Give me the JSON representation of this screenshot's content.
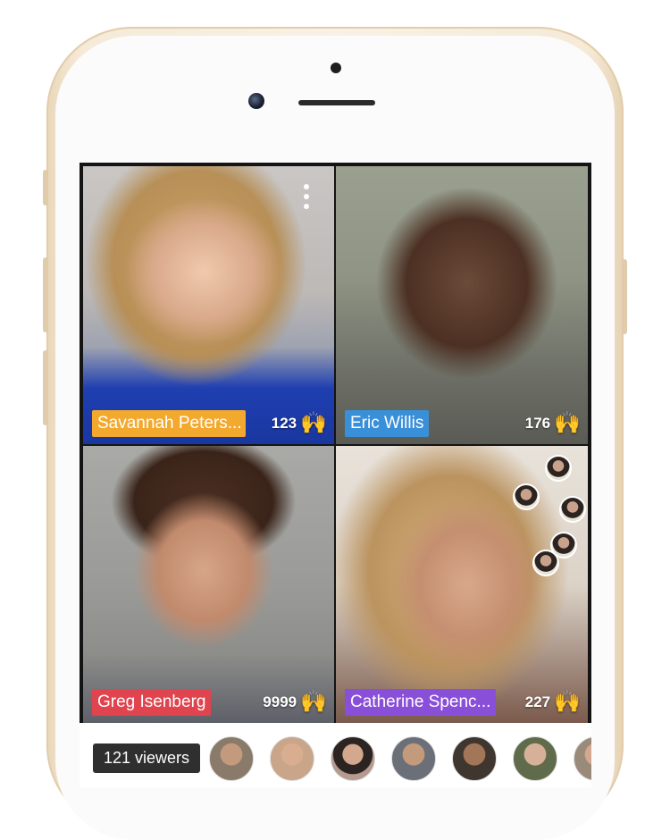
{
  "participants": [
    {
      "name": "Savannah Peters...",
      "claps": "123",
      "tag_color": "#f2a92e"
    },
    {
      "name": "Eric Willis",
      "claps": "176",
      "tag_color": "#3a8fd9"
    },
    {
      "name": "Greg Isenberg",
      "claps": "9999",
      "tag_color": "#e0444e"
    },
    {
      "name": "Catherine Spenc...",
      "claps": "227",
      "tag_color": "#8a4fd8"
    }
  ],
  "clap_icon": "raised-hands-icon",
  "clap_glyph": "🙌",
  "menu_icon": "vertical-dots-icon",
  "viewers": {
    "count_label": "121 viewers",
    "avatar_colors": [
      "#8a7a6a",
      "#c9a58a",
      "#b49a8f",
      "#6a6f78",
      "#3f3630",
      "#5f6b4a",
      "#9a8a7a"
    ]
  }
}
